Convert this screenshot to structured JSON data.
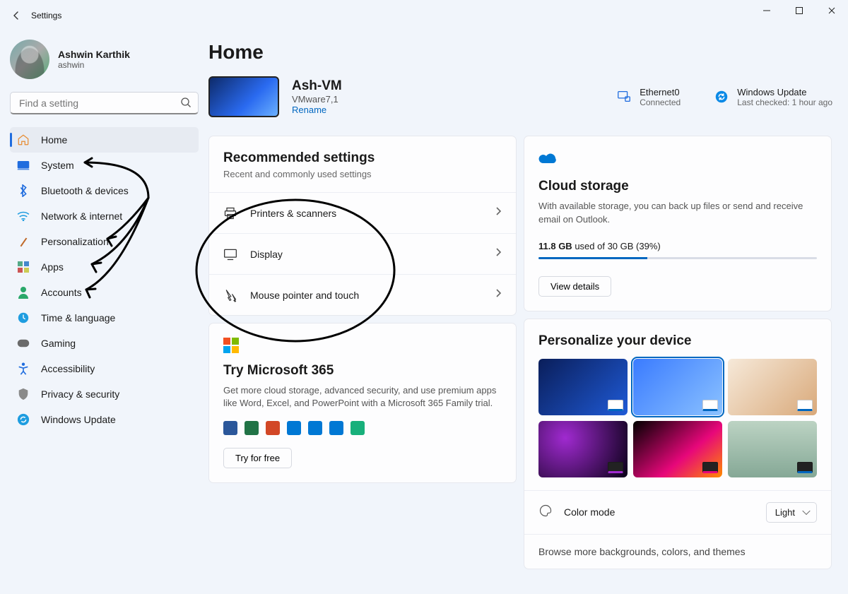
{
  "window": {
    "title": "Settings"
  },
  "user": {
    "name": "Ashwin Karthik",
    "handle": "ashwin"
  },
  "search": {
    "placeholder": "Find a setting"
  },
  "nav": [
    {
      "icon": "home-icon",
      "color": "#e78a2e",
      "label": "Home"
    },
    {
      "icon": "system-icon",
      "color": "#1f6cde",
      "label": "System"
    },
    {
      "icon": "bluetooth-icon",
      "color": "#1f6cde",
      "label": "Bluetooth & devices"
    },
    {
      "icon": "network-icon",
      "color": "#1f9de0",
      "label": "Network & internet"
    },
    {
      "icon": "personalize-icon",
      "color": "#c06a2a",
      "label": "Personalization"
    },
    {
      "icon": "apps-icon",
      "color": "#6a6a6a",
      "label": "Apps"
    },
    {
      "icon": "accounts-icon",
      "color": "#2aa86a",
      "label": "Accounts"
    },
    {
      "icon": "time-icon",
      "color": "#1f9de0",
      "label": "Time & language"
    },
    {
      "icon": "gaming-icon",
      "color": "#6a6a6a",
      "label": "Gaming"
    },
    {
      "icon": "accessibility-icon",
      "color": "#1f6cde",
      "label": "Accessibility"
    },
    {
      "icon": "privacy-icon",
      "color": "#8a8a8a",
      "label": "Privacy & security"
    },
    {
      "icon": "update-icon",
      "color": "#1f9de0",
      "label": "Windows Update"
    }
  ],
  "page": {
    "title": "Home"
  },
  "device": {
    "name": "Ash-VM",
    "model": "VMware7,1",
    "rename": "Rename"
  },
  "net": {
    "name": "Ethernet0",
    "status": "Connected"
  },
  "update": {
    "name": "Windows Update",
    "status": "Last checked: 1 hour ago"
  },
  "recommended": {
    "title": "Recommended settings",
    "subtitle": "Recent and commonly used settings",
    "items": [
      {
        "icon": "printer-icon",
        "label": "Printers & scanners"
      },
      {
        "icon": "display-icon",
        "label": "Display"
      },
      {
        "icon": "mouse-icon",
        "label": "Mouse pointer and touch"
      }
    ]
  },
  "m365": {
    "heading": "Try Microsoft 365",
    "desc": "Get more cloud storage, advanced security, and use premium apps like Word, Excel, and PowerPoint with a Microsoft 365 Family trial.",
    "cta": "Try for free",
    "app_colors": [
      "#2b579a",
      "#217346",
      "#d24726",
      "#0078d4",
      "#0078d4",
      "#0078d4",
      "#18b07b"
    ]
  },
  "cloud": {
    "heading": "Cloud storage",
    "desc": "With available storage, you can back up files or send and receive email on Outlook.",
    "used_gb": "11.8 GB",
    "rest": " used of 30 GB (39%)",
    "percent": 39,
    "cta": "View details"
  },
  "personalize": {
    "heading": "Personalize your device",
    "selected": 1,
    "color_mode_label": "Color mode",
    "color_mode_value": "Light",
    "browse": "Browse more backgrounds, colors, and themes"
  }
}
